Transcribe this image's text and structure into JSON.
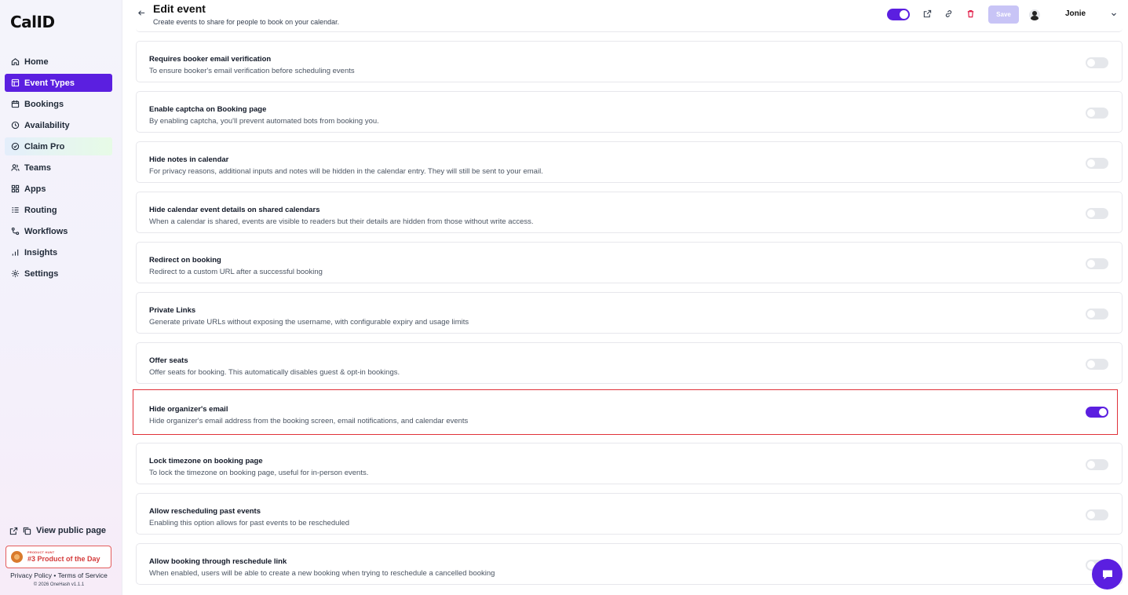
{
  "app": {
    "logo": "CalID"
  },
  "sidebar": {
    "items": [
      {
        "label": "Home",
        "icon": "home-icon"
      },
      {
        "label": "Event Types",
        "icon": "event-types-icon",
        "active": true
      },
      {
        "label": "Bookings",
        "icon": "calendar-icon"
      },
      {
        "label": "Availability",
        "icon": "clock-icon"
      },
      {
        "label": "Claim Pro",
        "icon": "badge-icon"
      },
      {
        "label": "Teams",
        "icon": "users-icon"
      },
      {
        "label": "Apps",
        "icon": "grid-icon"
      },
      {
        "label": "Routing",
        "icon": "list-icon"
      },
      {
        "label": "Workflows",
        "icon": "workflow-icon"
      },
      {
        "label": "Insights",
        "icon": "bar-chart-icon"
      },
      {
        "label": "Settings",
        "icon": "gear-icon"
      }
    ],
    "view_public": "View public page",
    "product_hunt": {
      "small": "PRODUCT HUNT",
      "big": "#3 Product of the Day"
    },
    "footer_links": "Privacy Policy • Terms of Service",
    "copyright": "© 2026 OneHash v1.1.1"
  },
  "header": {
    "title": "Edit event",
    "subtitle": "Create events to share for people to book on your calendar.",
    "save_label": "Save",
    "username": "Jonie",
    "enabled": true
  },
  "settings": [
    {
      "title": "Requires booker email verification",
      "desc": "To ensure booker's email verification before scheduling events",
      "on": false
    },
    {
      "title": "Enable captcha on Booking page",
      "desc": "By enabling captcha, you'll prevent automated bots from booking you.",
      "on": false
    },
    {
      "title": "Hide notes in calendar",
      "desc": "For privacy reasons, additional inputs and notes will be hidden in the calendar entry. They will still be sent to your email.",
      "on": false
    },
    {
      "title": "Hide calendar event details on shared calendars",
      "desc": "When a calendar is shared, events are visible to readers but their details are hidden from those without write access.",
      "on": false
    },
    {
      "title": "Redirect on booking",
      "desc": "Redirect to a custom URL after a successful booking",
      "on": false
    },
    {
      "title": "Private Links",
      "desc": "Generate private URLs without exposing the username, with configurable expiry and usage limits",
      "on": false
    },
    {
      "title": "Offer seats",
      "desc": "Offer seats for booking. This automatically disables guest & opt-in bookings.",
      "on": false
    },
    {
      "title": "Hide organizer's email",
      "desc": "Hide organizer's email address from the booking screen, email notifications, and calendar events",
      "on": true,
      "highlighted": true
    },
    {
      "title": "Lock timezone on booking page",
      "desc": "To lock the timezone on booking page, useful for in-person events.",
      "on": false
    },
    {
      "title": "Allow rescheduling past events",
      "desc": "Enabling this option allows for past events to be rescheduled",
      "on": false
    },
    {
      "title": "Allow booking through reschedule link",
      "desc": "When enabled, users will be able to create a new booking when trying to reschedule a cancelled booking",
      "on": false
    }
  ],
  "colors": {
    "accent": "#5b1fe0",
    "highlight_border": "#e0323a",
    "toggle_off": "#e5e7eb"
  }
}
